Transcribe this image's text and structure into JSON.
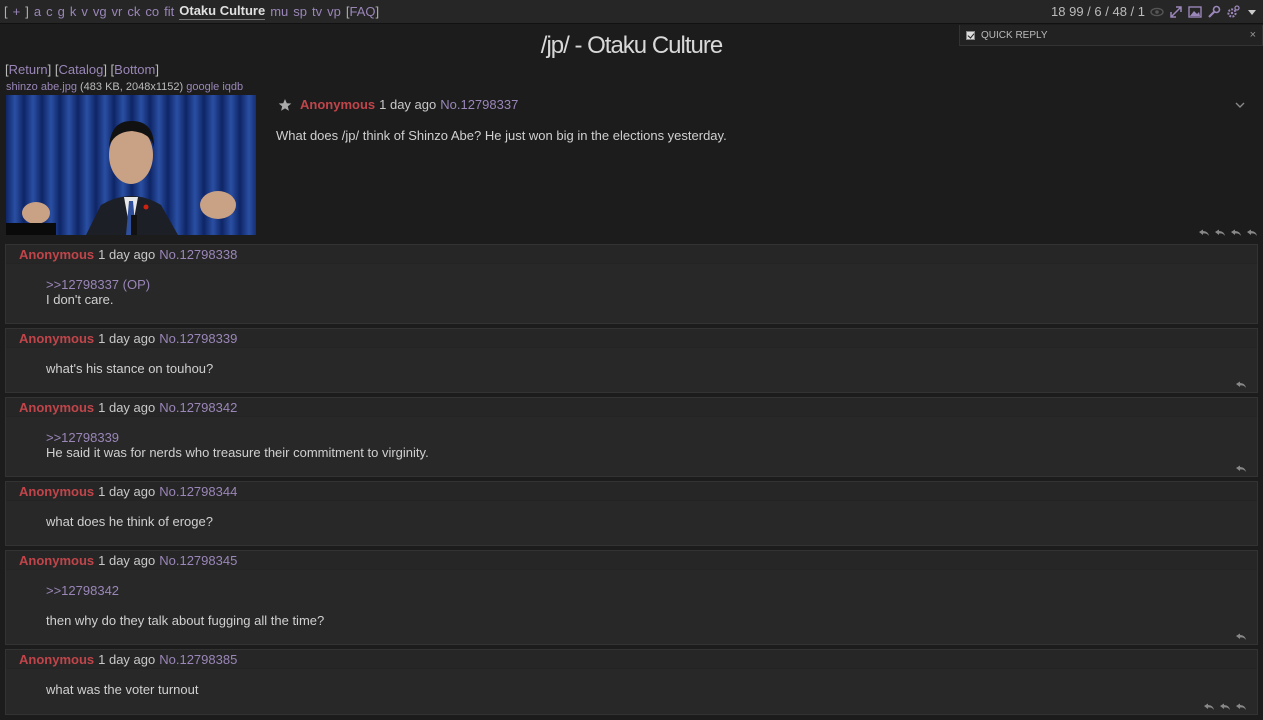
{
  "topbar": {
    "open_bracket": "[",
    "plus": "+",
    "close_bracket": "]",
    "boards": [
      "a",
      "c",
      "g",
      "k",
      "v",
      "vg",
      "vr",
      "ck",
      "co",
      "fit"
    ],
    "current_board": "Otaku Culture",
    "boards_after": [
      "mu",
      "sp",
      "tv",
      "vp"
    ],
    "faq": "FAQ",
    "stats": "18 99 / 6 / 48 / 1"
  },
  "quick_reply": {
    "label": "QUICK REPLY",
    "close": "×"
  },
  "board_title": "/jp/ - Otaku Culture",
  "nav": {
    "return": "Return",
    "catalog": "Catalog",
    "bottom": "Bottom"
  },
  "file": {
    "name": "shinzo abe.jpg",
    "meta": "(483 KB, 2048x1152)",
    "google": "google",
    "iqdb": "iqdb"
  },
  "op": {
    "name": "Anonymous",
    "date": "1 day ago",
    "postno": "No.12798337",
    "text": "What does /jp/ think of Shinzo Abe? He just won big in the elections yesterday."
  },
  "replies": [
    {
      "name": "Anonymous",
      "date": "1 day ago",
      "postno": "No.12798338",
      "quote": ">>12798337 (OP)",
      "text": "I don't care."
    },
    {
      "name": "Anonymous",
      "date": "1 day ago",
      "postno": "No.12798339",
      "quote": "",
      "text": "what's his stance on touhou?"
    },
    {
      "name": "Anonymous",
      "date": "1 day ago",
      "postno": "No.12798342",
      "quote": ">>12798339",
      "text": "He said it was for nerds who treasure their commitment to virginity."
    },
    {
      "name": "Anonymous",
      "date": "1 day ago",
      "postno": "No.12798344",
      "quote": "",
      "text": "what does he think of eroge?"
    },
    {
      "name": "Anonymous",
      "date": "1 day ago",
      "postno": "No.12798345",
      "quote": ">>12798342",
      "text": "then why do they talk about fugging all the time?"
    },
    {
      "name": "Anonymous",
      "date": "1 day ago",
      "postno": "No.12798385",
      "quote": "",
      "text": "what was the voter turnout"
    }
  ]
}
